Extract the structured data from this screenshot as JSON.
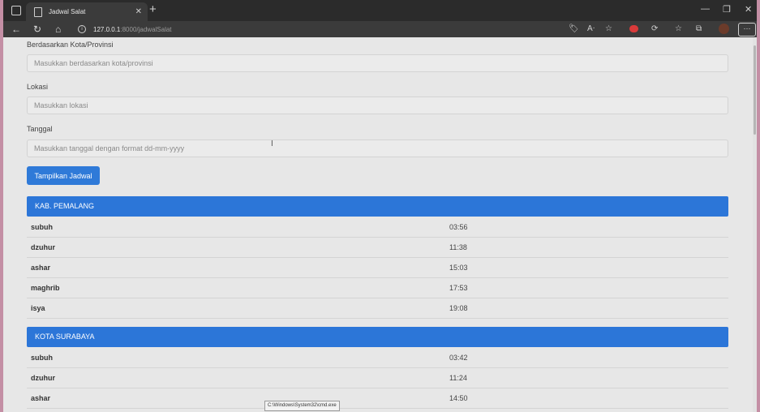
{
  "browser": {
    "tab_title": "Jadwal Salat",
    "url_host": "127.0.0.1",
    "url_path": ":8000/jadwalSalat"
  },
  "form": {
    "city_label": "Berdasarkan Kota/Provinsi",
    "city_placeholder": "Masukkan berdasarkan kota/provinsi",
    "location_label": "Lokasi",
    "location_placeholder": "Masukkan lokasi",
    "date_label": "Tanggal",
    "date_placeholder": "Masukkan tanggal dengan format dd-mm-yyyy",
    "submit_label": "Tampilkan Jadwal"
  },
  "schedules": [
    {
      "city": "KAB. PEMALANG",
      "times": [
        {
          "name": "subuh",
          "time": "03:56"
        },
        {
          "name": "dzuhur",
          "time": "11:38"
        },
        {
          "name": "ashar",
          "time": "15:03"
        },
        {
          "name": "maghrib",
          "time": "17:53"
        },
        {
          "name": "isya",
          "time": "19:08"
        }
      ]
    },
    {
      "city": "KOTA SURABAYA",
      "times": [
        {
          "name": "subuh",
          "time": "03:42"
        },
        {
          "name": "dzuhur",
          "time": "11:24"
        },
        {
          "name": "ashar",
          "time": "14:50"
        }
      ]
    }
  ],
  "tooltip": "C:\\Windows\\System32\\cmd.exe",
  "colors": {
    "accent": "#2c76d8",
    "button": "#2f7ad8"
  }
}
